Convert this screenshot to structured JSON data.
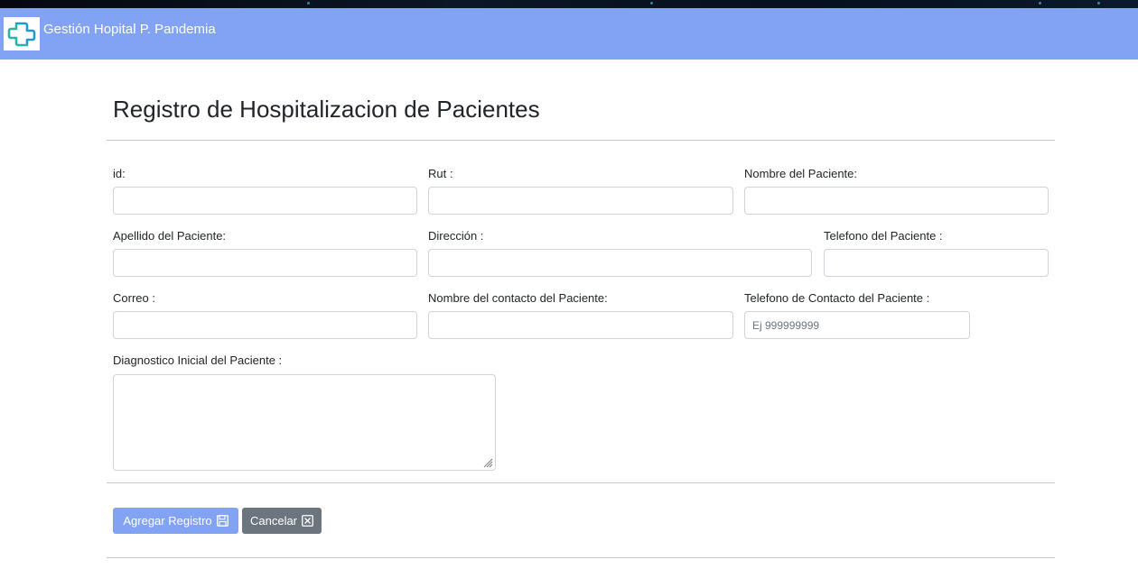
{
  "app": {
    "title": "Gestión Hopital P. Pandemia"
  },
  "page": {
    "title": "Registro de Hospitalizacion de Pacientes"
  },
  "form": {
    "id_label": "id:",
    "rut_label": "Rut :",
    "nombre_label": "Nombre del Paciente:",
    "apellido_label": "Apellido del Paciente:",
    "direccion_label": "Dirección :",
    "telefono_label": "Telefono del Paciente :",
    "correo_label": "Correo :",
    "contacto_nombre_label": "Nombre del contacto del Paciente:",
    "contacto_telefono_label": "Telefono de Contacto del Paciente :",
    "contacto_telefono_placeholder": "Ej 999999999",
    "diagnostico_label": "Diagnostico Inicial del Paciente :"
  },
  "actions": {
    "agregar_label": "Agregar Registro",
    "cancelar_label": "Cancelar"
  },
  "colors": {
    "navbar": "#82a2f4",
    "primary_button": "#82a2f4",
    "secondary_button": "#6c757d"
  },
  "icons": {
    "logo": "hospital-cross-logo-icon",
    "save": "floppy-disk-icon",
    "cancel": "close-box-icon"
  }
}
